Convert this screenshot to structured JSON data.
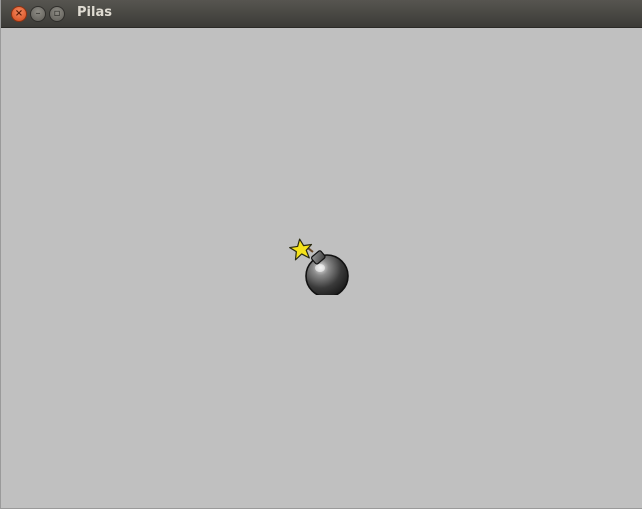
{
  "window": {
    "title": "Pilas",
    "controls": {
      "close_icon": "close-icon",
      "minimize_icon": "minimize-icon",
      "maximize_icon": "maximize-icon"
    }
  },
  "canvas": {
    "background": "#c0c0c0",
    "actors": [
      {
        "type": "bomb",
        "icon": "bomb-icon"
      }
    ]
  },
  "colors": {
    "titlebar": "#3c3b37",
    "close_button": "#e05a26",
    "spark": "#f5e21a"
  }
}
